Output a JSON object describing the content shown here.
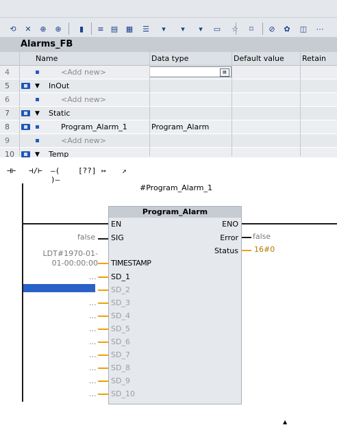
{
  "toolbar": {
    "icons": [
      "var-refresh-icon",
      "var-delete-icon",
      "var-insert-icon",
      "var-insert2-icon",
      "clear-icon",
      "block-icon",
      "list-icon",
      "absolute-icon",
      "comment-icon",
      "network-down-icon",
      "favorites-down-icon",
      "monitor-down-icon",
      "pane-icon",
      "favorites-icon",
      "lad-box-icon",
      "go-to-error-icon",
      "monitoring-icon",
      "snapshot-icon",
      "more-icon"
    ]
  },
  "block": {
    "title": "Alarms_FB"
  },
  "interface": {
    "columns": [
      "Name",
      "Data type",
      "Default value",
      "Retain"
    ],
    "rows": [
      {
        "num": "4",
        "name": "<Add new>",
        "type": "",
        "kind": "addnew",
        "editing": true
      },
      {
        "num": "5",
        "name": "InOut",
        "type": "",
        "kind": "section"
      },
      {
        "num": "6",
        "name": "<Add new>",
        "type": "",
        "kind": "addnew"
      },
      {
        "num": "7",
        "name": "Static",
        "type": "",
        "kind": "section"
      },
      {
        "num": "8",
        "name": "Program_Alarm_1",
        "type": "Program_Alarm",
        "kind": "var"
      },
      {
        "num": "9",
        "name": "<Add new>",
        "type": "",
        "kind": "addnew"
      },
      {
        "num": "10",
        "name": "Temp",
        "type": "",
        "kind": "section"
      }
    ]
  },
  "lad_toolbar": {
    "items": [
      {
        "name": "no-contact-icon",
        "glyph": "⊣⊢"
      },
      {
        "name": "nc-contact-icon",
        "glyph": "⊣/⊢"
      },
      {
        "name": "coil-icon",
        "glyph": "–( )–"
      },
      {
        "name": "empty-box-icon",
        "glyph": "[??]"
      },
      {
        "name": "open-branch-icon",
        "glyph": "↦"
      },
      {
        "name": "close-branch-icon",
        "glyph": "↗"
      }
    ]
  },
  "network": {
    "instance_label": "#Program_Alarm_1",
    "fb_name": "Program_Alarm",
    "pins_left": [
      "EN",
      "SIG",
      "TIMESTAMP",
      "SD_1",
      "SD_2",
      "SD_3",
      "SD_4",
      "SD_5",
      "SD_6",
      "SD_7",
      "SD_8",
      "SD_9",
      "SD_10"
    ],
    "pins_right": [
      "ENO",
      "Error",
      "Status"
    ],
    "sig_value": "false",
    "timestamp_value": "LDT#1970-01-01-00:00:00",
    "sd_param_placeholder": "...",
    "error_value": "false",
    "status_value": "16#0"
  }
}
